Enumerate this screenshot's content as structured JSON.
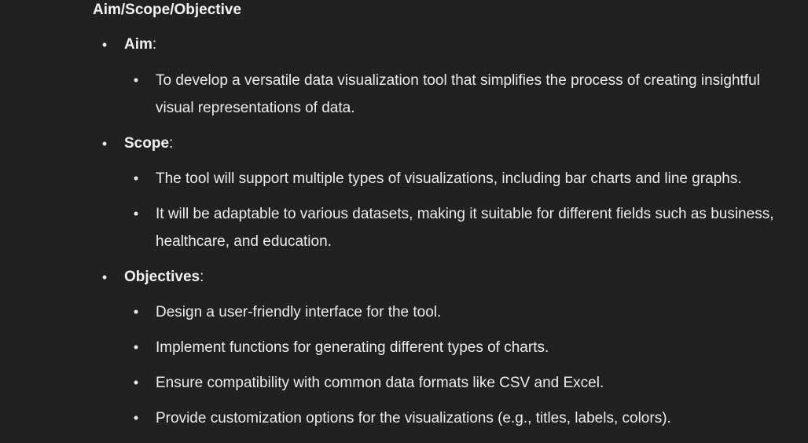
{
  "heading": "Aim/Scope/Objective",
  "bullet_glyph": "•",
  "sections": {
    "aim": {
      "label": "Aim",
      "colon": ":",
      "items": [
        "To develop a versatile data visualization tool that simplifies the process of creating insightful visual representations of data."
      ]
    },
    "scope": {
      "label": "Scope",
      "colon": ":",
      "items": [
        "The tool will support multiple types of visualizations, including bar charts and line graphs.",
        "It will be adaptable to various datasets, making it suitable for different fields such as business, healthcare, and education."
      ]
    },
    "objectives": {
      "label": "Objectives",
      "colon": ":",
      "items": [
        "Design a user-friendly interface for the tool.",
        "Implement functions for generating different types of charts.",
        "Ensure compatibility with common data formats like CSV and Excel.",
        "Provide customization options for the visualizations (e.g., titles, labels, colors)."
      ]
    }
  },
  "colors": {
    "background": "#212121",
    "text": "#ececec"
  }
}
